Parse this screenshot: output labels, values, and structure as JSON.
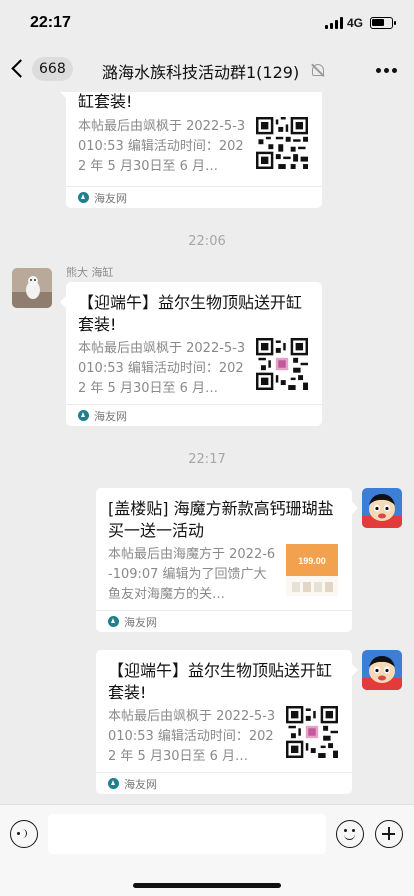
{
  "status_bar": {
    "time": "22:17",
    "network": "4G",
    "icons": [
      "signal-icon",
      "battery-icon"
    ]
  },
  "nav": {
    "back_icon": "chevron-left-icon",
    "unread_count": "668",
    "title": "潞海水族科技活动群1(129)",
    "mute_icon": "mute-bell-icon",
    "more_icon": "more-dots-icon"
  },
  "messages": [
    {
      "side": "left",
      "title": "缸套装!",
      "description": "本帖最后由飒枫于 2022-5-3010:53 编辑活动时间：2022 年 5 月30日至 6 月…",
      "source": "海友网",
      "thumb": "qr-code-image"
    },
    {
      "time": "22:06",
      "side": "left",
      "sender": "熊大 海缸",
      "title": "【迎端午】益尔生物顶贴送开缸套装!",
      "description": "本帖最后由飒枫于 2022-5-3010:53 编辑活动时间：2022 年 5 月30日至 6 月…",
      "source": "海友网",
      "thumb": "qr-code-image"
    },
    {
      "time": "22:17",
      "side": "right",
      "title": "[盖楼贴] 海魔方新款高钙珊瑚盐买一送一活动",
      "description": "本帖最后由海魔方于 2022-6-109:07 编辑为了回馈广大鱼友对海魔方的关…",
      "source": "海友网",
      "thumb": "promo-image",
      "thumb_text": "199.00"
    },
    {
      "side": "right",
      "title": "【迎端午】益尔生物顶贴送开缸套装!",
      "description": "本帖最后由飒枫于 2022-5-3010:53 编辑活动时间：2022 年 5 月30日至 6 月…",
      "source": "海友网",
      "thumb": "qr-code-image"
    }
  ],
  "input_bar": {
    "voice_icon": "voice-icon",
    "emoji_icon": "emoji-icon",
    "plus_icon": "plus-icon",
    "input_value": ""
  },
  "colors": {
    "background": "#ededed",
    "bubble": "#ffffff",
    "secondary_text": "#8a8a8a"
  }
}
